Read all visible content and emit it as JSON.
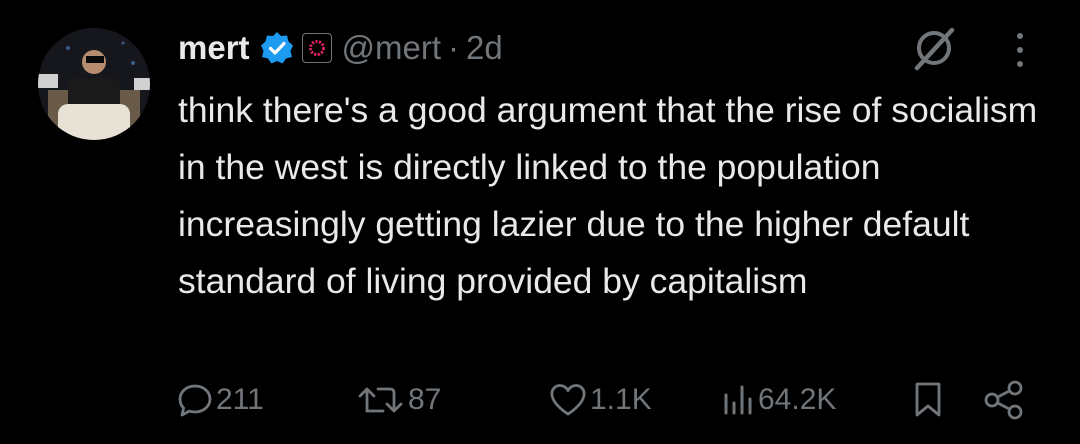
{
  "author": {
    "display_name": "mert",
    "handle": "@mert",
    "separator": "·",
    "timestamp": "2d",
    "verified_icon": "verified-badge-icon",
    "affiliation_icon": "org-affiliation-badge-icon"
  },
  "tweet": {
    "text": "think there's a good argument that the rise of socialism in the west is directly linked to the population increasingly getting lazier due to the higher default standard of living provided by capitalism"
  },
  "actions": {
    "replies": "211",
    "reposts": "87",
    "likes": "1.1K",
    "views": "64.2K"
  },
  "colors": {
    "background": "#000000",
    "text": "#e7e9ea",
    "muted": "#71767b",
    "verified": "#1d9bf0",
    "affiliation_accent": "#e0245e"
  }
}
